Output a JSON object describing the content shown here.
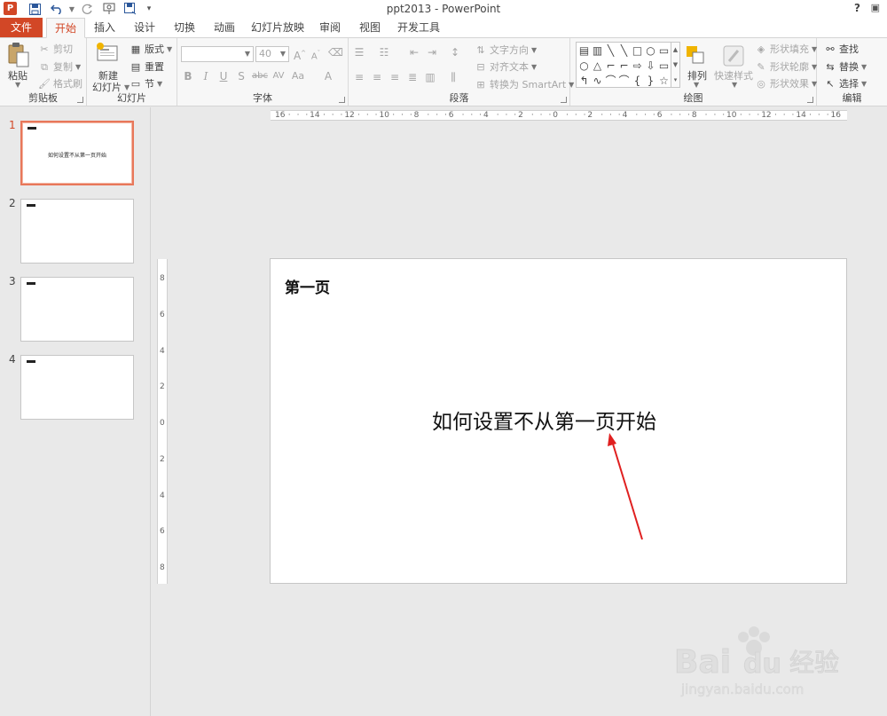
{
  "window": {
    "title": "ppt2013 - PowerPoint",
    "help": "?"
  },
  "quick_access": [
    "ppt-logo",
    "save-icon",
    "undo-icon",
    "redo-icon",
    "from-beginning-icon",
    "save-as-icon",
    "customize-icon"
  ],
  "tabs": [
    {
      "label": "文件",
      "left": 0
    },
    {
      "label": "开始"
    },
    {
      "label": "插入"
    },
    {
      "label": "设计"
    },
    {
      "label": "切换"
    },
    {
      "label": "动画"
    },
    {
      "label": "幻灯片放映"
    },
    {
      "label": "审阅"
    },
    {
      "label": "视图"
    },
    {
      "label": "开发工具"
    }
  ],
  "ribbon": {
    "clipboard": {
      "label": "剪贴板",
      "paste": "粘贴",
      "cut": "剪切",
      "copy": "复制",
      "format_painter": "格式刷"
    },
    "slides": {
      "label": "幻灯片",
      "new_slide_line1": "新建",
      "new_slide_line2": "幻灯片",
      "layout": "版式",
      "reset": "重置",
      "section": "节"
    },
    "font": {
      "label": "字体",
      "font_name": "",
      "font_size": "40",
      "bold": "B",
      "italic": "I",
      "underline": "U",
      "shadow": "S",
      "strike": "abc",
      "spacing": "AV",
      "case": "Aa",
      "color": "A",
      "grow": "A",
      "shrink": "A"
    },
    "paragraph": {
      "label": "段落",
      "text_direction": "文字方向",
      "align_text": "对齐文本",
      "convert_smartart": "转换为 SmartArt"
    },
    "drawing": {
      "label": "绘图",
      "arrange": "排列",
      "quick_styles": "快速样式",
      "shape_fill": "形状填充",
      "shape_outline": "形状轮廓",
      "shape_effects": "形状效果",
      "shapes": [
        "▤",
        "▥",
        "╲",
        "╲",
        "□",
        "○",
        "▭",
        "○",
        "△",
        "⌐",
        "⌐",
        "⇨",
        "⇩",
        "▭",
        "↰",
        "∿",
        "⌒",
        "⌒",
        "{",
        "}",
        "☆"
      ]
    },
    "editing": {
      "label": "编辑",
      "find": "查找",
      "replace": "替换",
      "select": "选择"
    }
  },
  "rulers": {
    "horizontal": [
      "16",
      "14",
      "12",
      "10",
      "8",
      "6",
      "4",
      "2",
      "0",
      "2",
      "4",
      "6",
      "8",
      "10",
      "12",
      "14",
      "16"
    ],
    "vertical": [
      "8",
      "6",
      "4",
      "2",
      "0",
      "2",
      "4",
      "6",
      "8"
    ]
  },
  "thumbnails": [
    {
      "num": "1",
      "text": "如何设置不从第一页开始",
      "active": true
    },
    {
      "num": "2",
      "text": "",
      "active": false
    },
    {
      "num": "3",
      "text": "",
      "active": false
    },
    {
      "num": "4",
      "text": "",
      "active": false
    }
  ],
  "slide": {
    "title": "第一页",
    "body": "如何设置不从第一页开始"
  },
  "watermark": {
    "brand": "Bai du 经验",
    "url": "jingyan.baidu.com"
  },
  "colors": {
    "accent": "#d24726",
    "annotation_arrow": "#e02020"
  }
}
